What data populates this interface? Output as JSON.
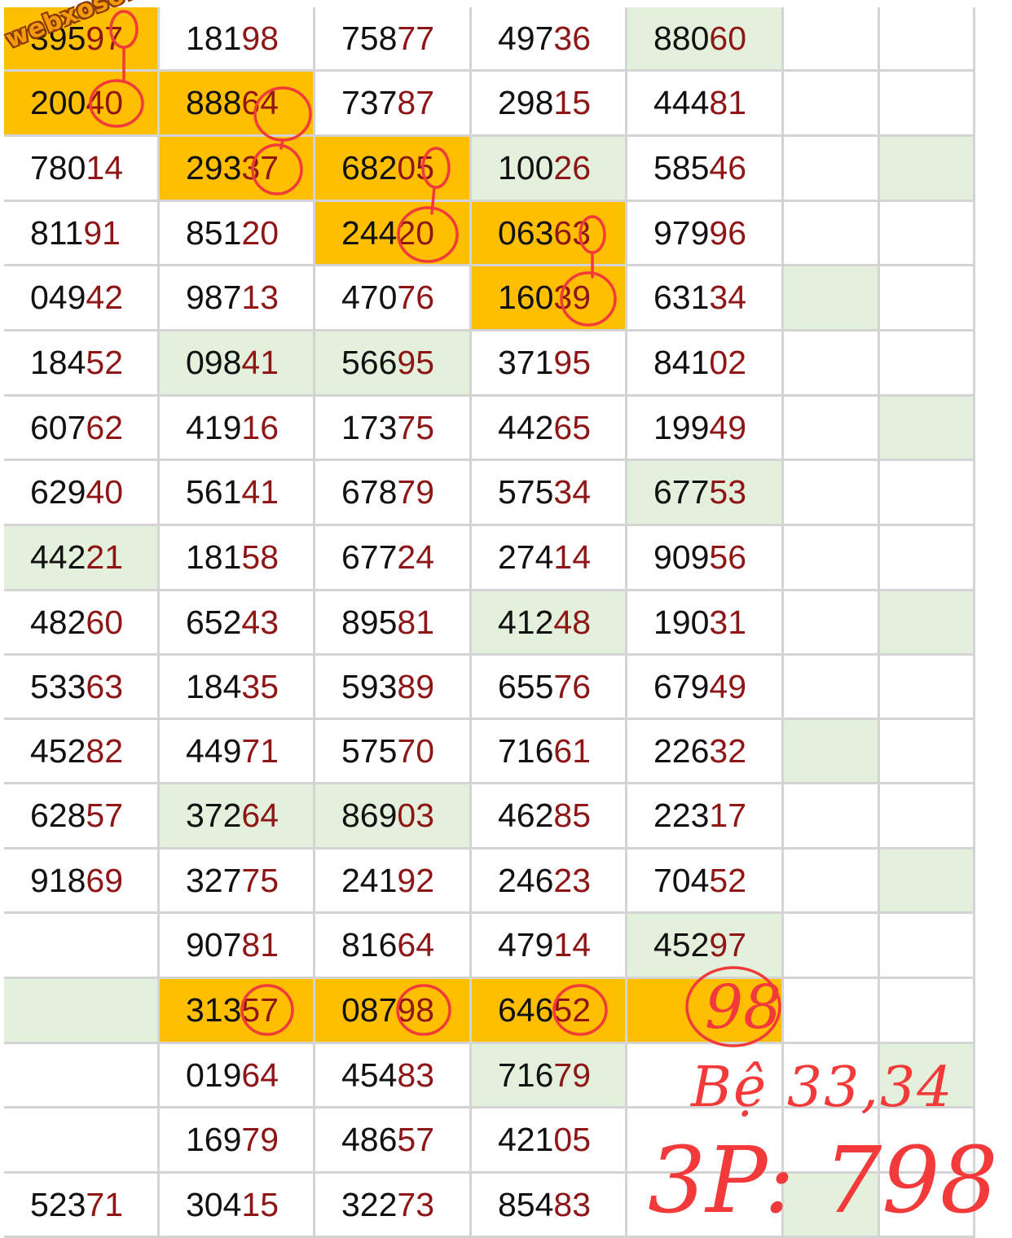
{
  "watermark": "webxoso.net",
  "table": {
    "rows": [
      [
        "39597",
        "18198",
        "75877",
        "49736",
        "88060",
        "",
        ""
      ],
      [
        "20040",
        "88864",
        "73787",
        "29815",
        "44481",
        "",
        ""
      ],
      [
        "78014",
        "29337",
        "68205",
        "10026",
        "58546",
        "",
        ""
      ],
      [
        "81191",
        "85120",
        "24420",
        "06363",
        "97996",
        "",
        ""
      ],
      [
        "04942",
        "98713",
        "47076",
        "16039",
        "63134",
        "",
        ""
      ],
      [
        "18452",
        "09841",
        "56695",
        "37195",
        "84102",
        "",
        ""
      ],
      [
        "60762",
        "41916",
        "17375",
        "44265",
        "19949",
        "",
        ""
      ],
      [
        "62940",
        "56141",
        "67879",
        "57534",
        "67753",
        "",
        ""
      ],
      [
        "44221",
        "18158",
        "67724",
        "27414",
        "90956",
        "",
        ""
      ],
      [
        "48260",
        "65243",
        "89581",
        "41248",
        "19031",
        "",
        ""
      ],
      [
        "53363",
        "18435",
        "59389",
        "65576",
        "67949",
        "",
        ""
      ],
      [
        "45282",
        "44971",
        "57570",
        "71661",
        "22632",
        "",
        ""
      ],
      [
        "62857",
        "37264",
        "86903",
        "46285",
        "22317",
        "",
        ""
      ],
      [
        "91869",
        "32775",
        "24192",
        "24623",
        "70452",
        "",
        ""
      ],
      [
        "",
        "90781",
        "81664",
        "47914",
        "45297",
        "",
        ""
      ],
      [
        "",
        "31357",
        "08798",
        "64652",
        "",
        "",
        ""
      ],
      [
        "",
        "01964",
        "45483",
        "71679",
        "",
        "",
        ""
      ],
      [
        "",
        "16979",
        "48657",
        "42105",
        "",
        "",
        ""
      ],
      [
        "52371",
        "30415",
        "32273",
        "85483",
        "",
        "",
        ""
      ]
    ],
    "highlighted_cells": [
      [
        0,
        0
      ],
      [
        1,
        0
      ],
      [
        1,
        1
      ],
      [
        2,
        1
      ],
      [
        2,
        2
      ],
      [
        3,
        2
      ],
      [
        3,
        3
      ],
      [
        4,
        3
      ],
      [
        15,
        1
      ],
      [
        15,
        2
      ],
      [
        15,
        3
      ],
      [
        15,
        4
      ]
    ],
    "green_cells": [
      [
        0,
        4
      ],
      [
        2,
        3
      ],
      [
        2,
        6
      ],
      [
        4,
        5
      ],
      [
        5,
        1
      ],
      [
        5,
        2
      ],
      [
        6,
        6
      ],
      [
        7,
        4
      ],
      [
        8,
        0
      ],
      [
        9,
        3
      ],
      [
        9,
        6
      ],
      [
        11,
        5
      ],
      [
        12,
        1
      ],
      [
        12,
        2
      ],
      [
        13,
        6
      ],
      [
        14,
        4
      ],
      [
        15,
        0
      ],
      [
        16,
        3
      ],
      [
        16,
        6
      ],
      [
        18,
        5
      ]
    ]
  },
  "annotations": {
    "circled_98": "98",
    "note_line1": "Bệ 33,34",
    "note_line2": "3P: 798"
  },
  "colors": {
    "highlight": "#ffbf00",
    "green_cell": "#e3f0db",
    "red_digits": "#8e1616",
    "ink": "#f23a3a",
    "grid_line": "#d4d4d4"
  }
}
